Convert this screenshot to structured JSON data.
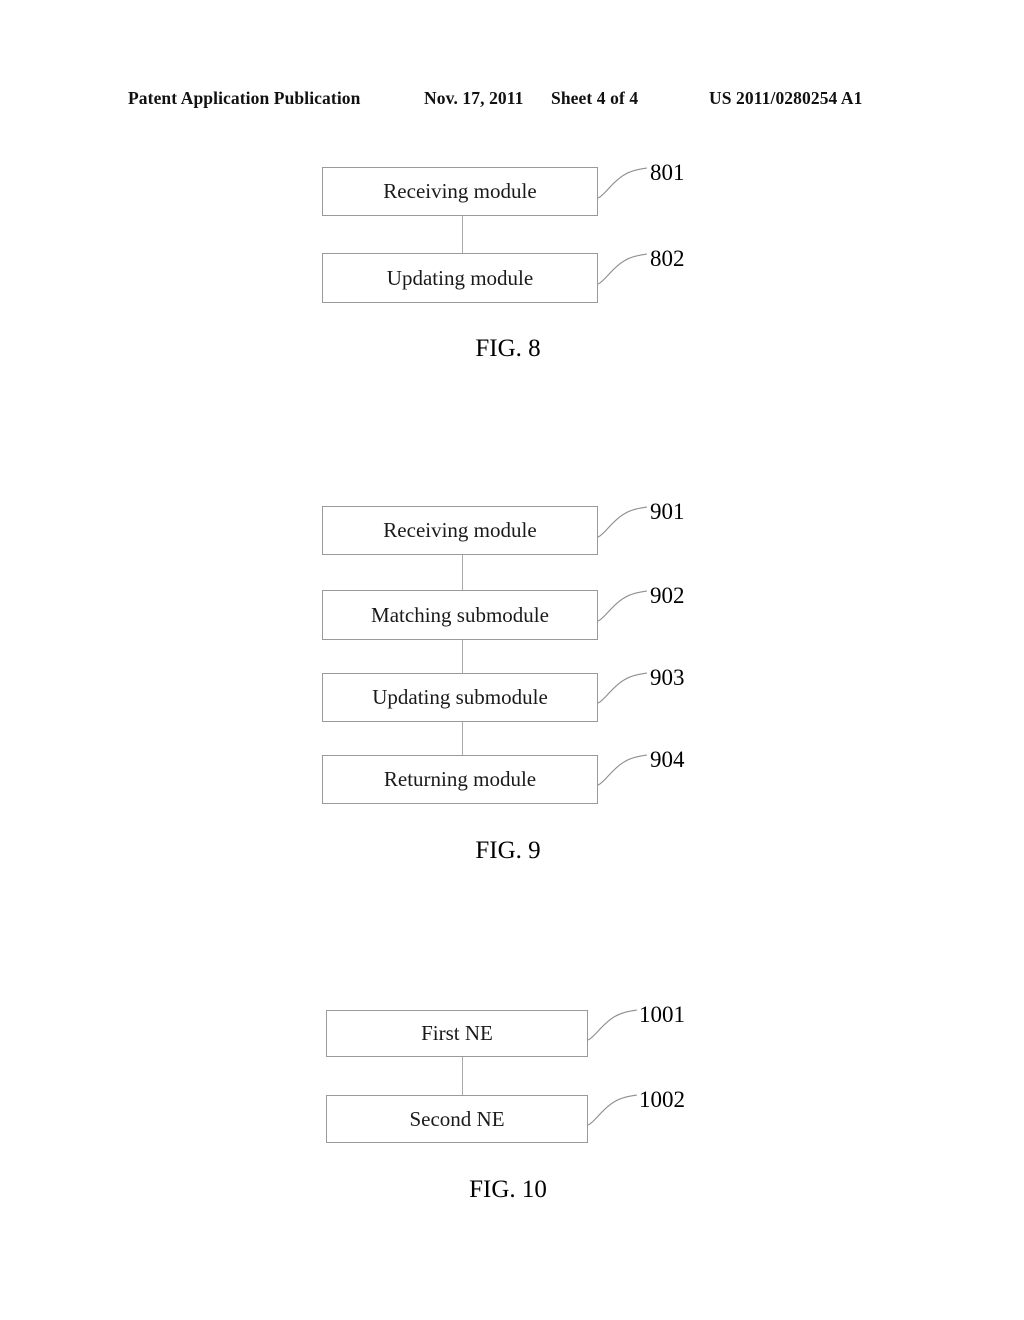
{
  "header": {
    "publication": "Patent Application Publication",
    "date": "Nov. 17, 2011",
    "sheet": "Sheet 4 of 4",
    "patent_number": "US 2011/0280254 A1"
  },
  "figures": [
    {
      "caption": "FIG. 8",
      "nodes": [
        {
          "label": "Receiving module",
          "ref": "801"
        },
        {
          "label": "Updating module",
          "ref": "802"
        }
      ]
    },
    {
      "caption": "FIG. 9",
      "nodes": [
        {
          "label": "Receiving module",
          "ref": "901"
        },
        {
          "label": "Matching submodule",
          "ref": "902"
        },
        {
          "label": "Updating submodule",
          "ref": "903"
        },
        {
          "label": "Returning module",
          "ref": "904"
        }
      ]
    },
    {
      "caption": "FIG. 10",
      "nodes": [
        {
          "label": "First NE",
          "ref": "1001"
        },
        {
          "label": "Second NE",
          "ref": "1002"
        }
      ]
    }
  ],
  "colors": {
    "page_background": "#ffffff",
    "box_border": "#9a9a9a",
    "connector": "#aaaaaa",
    "leader": "#8e8e8e",
    "text": "#000000"
  }
}
